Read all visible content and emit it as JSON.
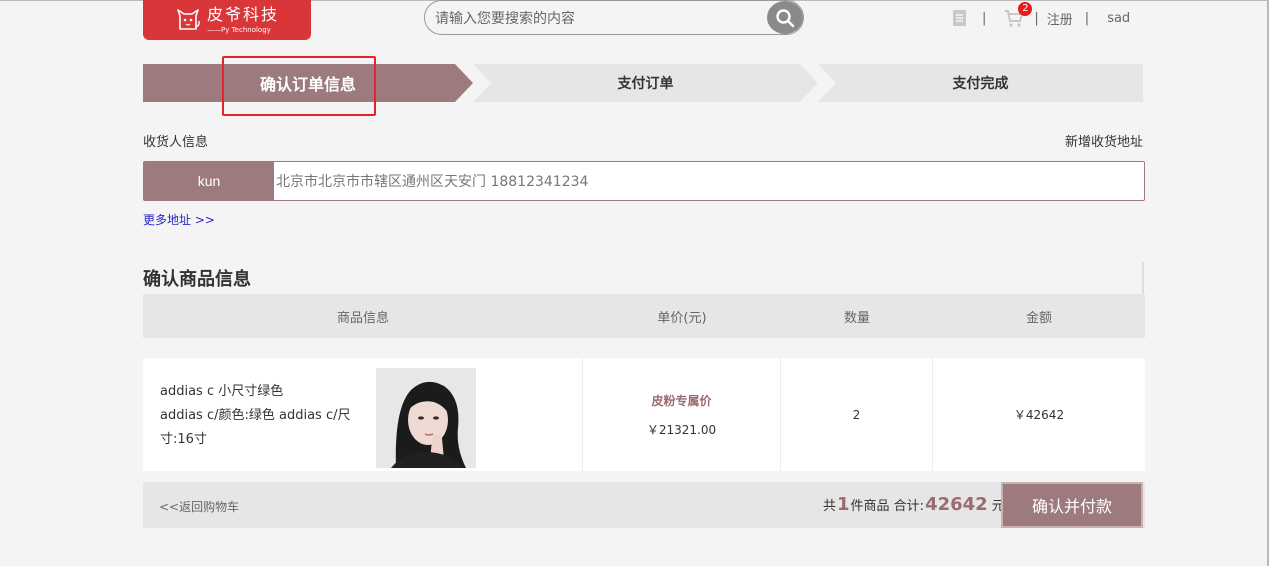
{
  "header": {
    "logo_name": "皮爷科技",
    "logo_sub": "——Py Technology",
    "search_placeholder": "请输入您要搜索的内容",
    "cart_count": "2",
    "register": "注册",
    "username": "sad",
    "sep": "|"
  },
  "steps": {
    "step1": "确认订单信息",
    "step2": "支付订单",
    "step3": "支付完成"
  },
  "receiver": {
    "title": "收货人信息",
    "new_address": "新增收货地址",
    "name": "kun",
    "address": "北京市北京市市辖区通州区天安门  18812341234",
    "more": "更多地址 >>"
  },
  "goods": {
    "title": "确认商品信息",
    "headers": [
      "商品信息",
      "单价(元)",
      "数量",
      "金额"
    ],
    "item": {
      "line1": "addias c 小尺寸绿色",
      "line2": "addias c/颜色:绿色  addias c/尺寸:16寸",
      "price_tag": "皮粉专属价",
      "price": "￥21321.00",
      "qty": "2",
      "amount": "￥42642"
    }
  },
  "footer": {
    "back": "<<返回购物车",
    "count_prefix": "共",
    "count": "1",
    "count_suffix": "件商品  合计:",
    "total": "42642",
    "unit": "元",
    "pay": "确认并付款"
  },
  "colors": {
    "accent": "#9c7a7e",
    "logo_red": "#d9363a",
    "highlight": "#e3242b"
  }
}
